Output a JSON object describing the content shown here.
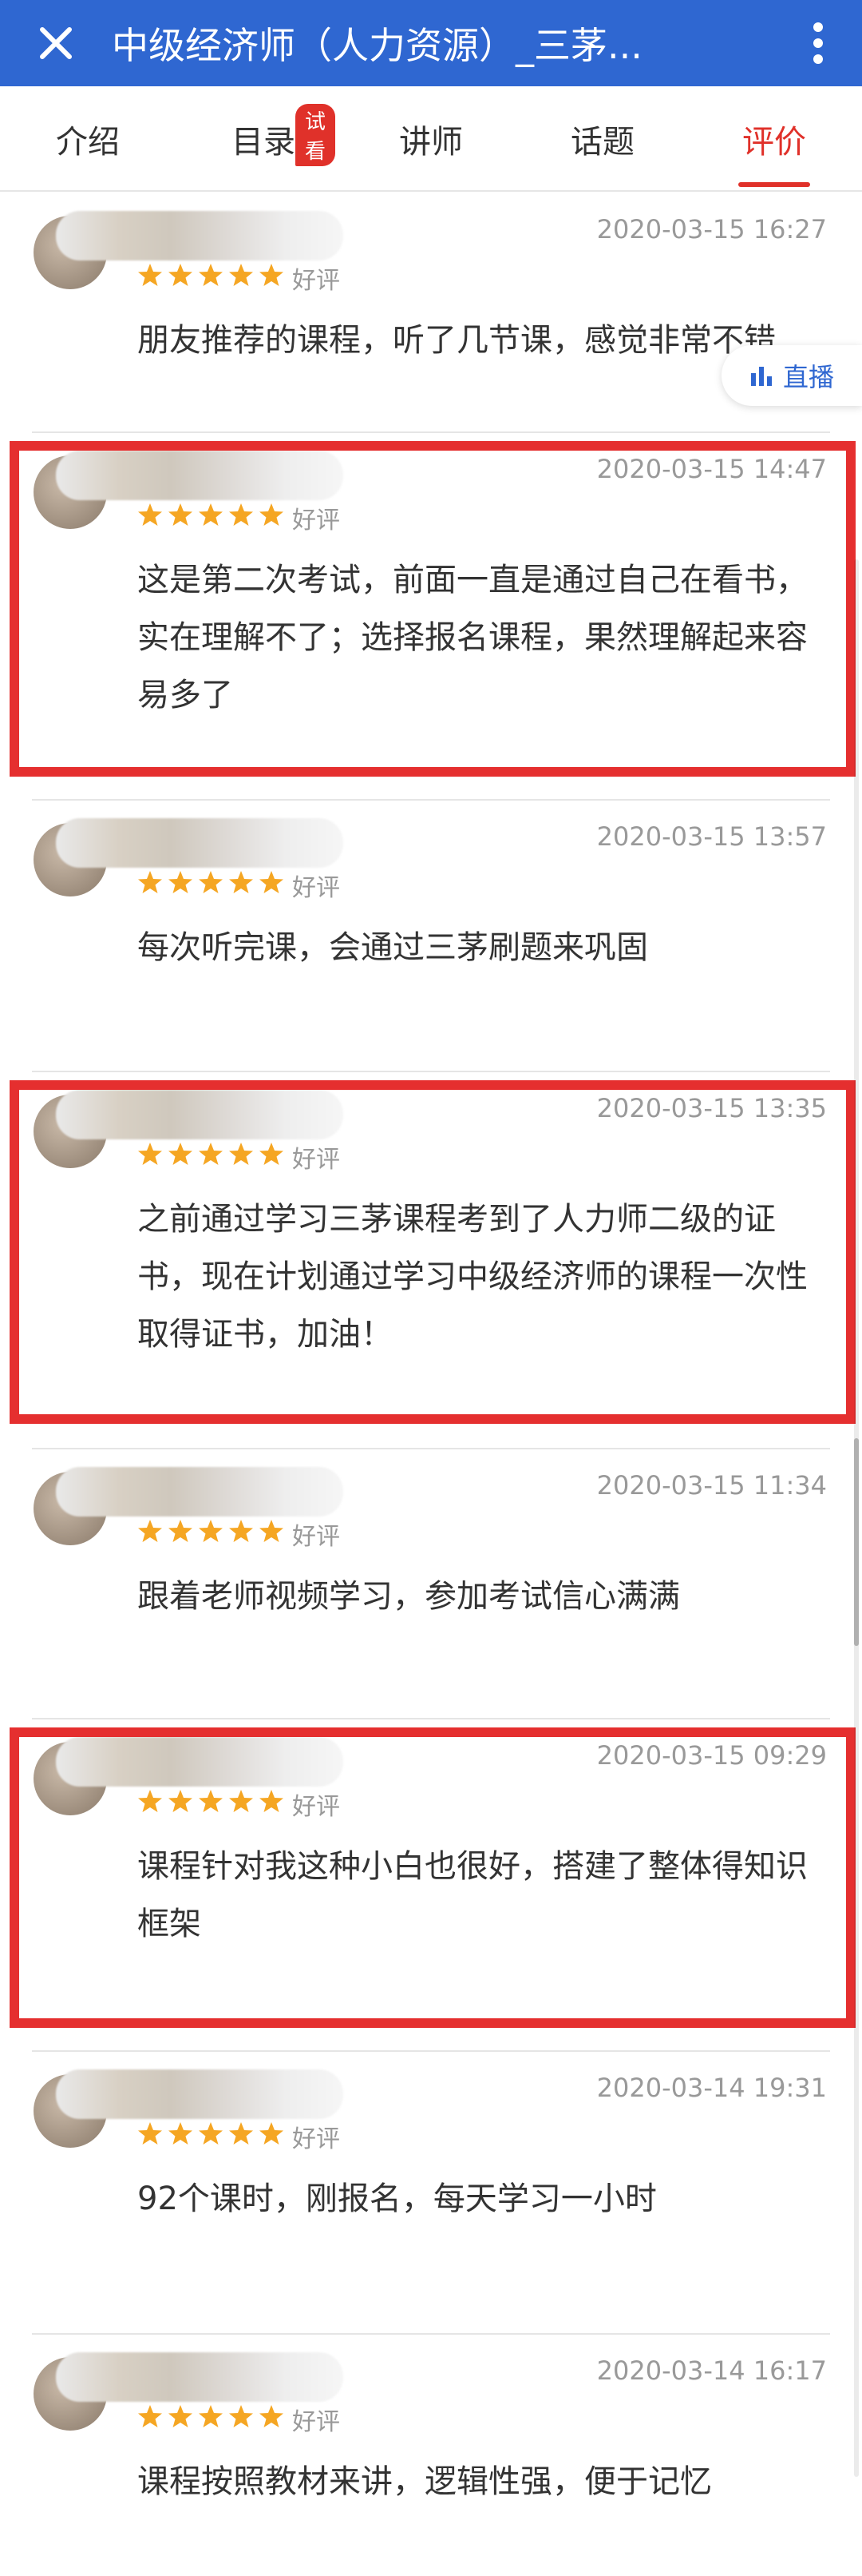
{
  "appbar": {
    "title": "中级经济师（人力资源）_三茅...",
    "close_icon": "close-icon",
    "more_icon": "more-vertical-icon"
  },
  "tabs": [
    {
      "label": "介绍"
    },
    {
      "label": "目录",
      "badge": "试看"
    },
    {
      "label": "讲师"
    },
    {
      "label": "话题"
    },
    {
      "label": "评价",
      "active": true
    }
  ],
  "live_button": {
    "label": "直播",
    "icon": "bar-chart-icon"
  },
  "reviews": [
    {
      "time": "2020-03-15 16:27",
      "rating": 5,
      "rating_label": "好评",
      "text": "朋友推荐的课程，听了几节课，感觉非常不错"
    },
    {
      "time": "2020-03-15 14:47",
      "rating": 5,
      "rating_label": "好评",
      "text": "这是第二次考试，前面一直是通过自己在看书，实在理解不了；选择报名课程，果然理解起来容易多了",
      "highlighted": true
    },
    {
      "time": "2020-03-15 13:57",
      "rating": 5,
      "rating_label": "好评",
      "text": "每次听完课，会通过三茅刷题来巩固"
    },
    {
      "time": "2020-03-15 13:35",
      "rating": 5,
      "rating_label": "好评",
      "text": "之前通过学习三茅课程考到了人力师二级的证书，现在计划通过学习中级经济师的课程一次性取得证书，加油！",
      "highlighted": true
    },
    {
      "time": "2020-03-15 11:34",
      "rating": 5,
      "rating_label": "好评",
      "text": "跟着老师视频学习，参加考试信心满满"
    },
    {
      "time": "2020-03-15 09:29",
      "rating": 5,
      "rating_label": "好评",
      "text": "课程针对我这种小白也很好，搭建了整体得知识框架",
      "highlighted": true
    },
    {
      "time": "2020-03-14 19:31",
      "rating": 5,
      "rating_label": "好评",
      "text": "92个课时，刚报名，每天学习一小时"
    },
    {
      "time": "2020-03-14 16:17",
      "rating": 5,
      "rating_label": "好评",
      "text": "课程按照教材来讲，逻辑性强，便于记忆"
    }
  ],
  "colors": {
    "primary": "#2f67d1",
    "accent": "#e0312a",
    "star": "#f5a623"
  }
}
